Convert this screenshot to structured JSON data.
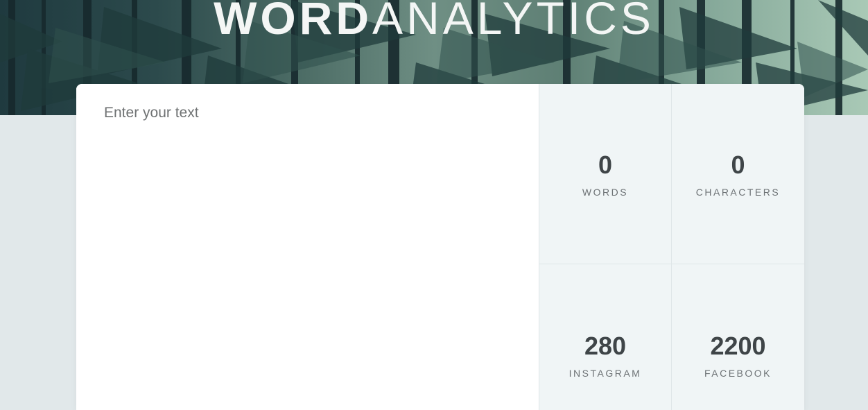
{
  "header": {
    "logo_bold": "WORD",
    "logo_light": "ANALYTICS",
    "background_image": "forest-image"
  },
  "editor": {
    "placeholder": "Enter your text",
    "value": ""
  },
  "stats": {
    "words": {
      "value": "0",
      "label": "WORDS"
    },
    "characters": {
      "value": "0",
      "label": "CHARACTERS"
    },
    "instagram": {
      "value": "280",
      "label": "INSTAGRAM"
    },
    "facebook": {
      "value": "2200",
      "label": "FACEBOOK"
    }
  },
  "colors": {
    "page_bg": "#e1e8ea",
    "stats_bg": "#f0f5f6",
    "number_text": "#3f4548",
    "label_text": "#6d7275"
  }
}
